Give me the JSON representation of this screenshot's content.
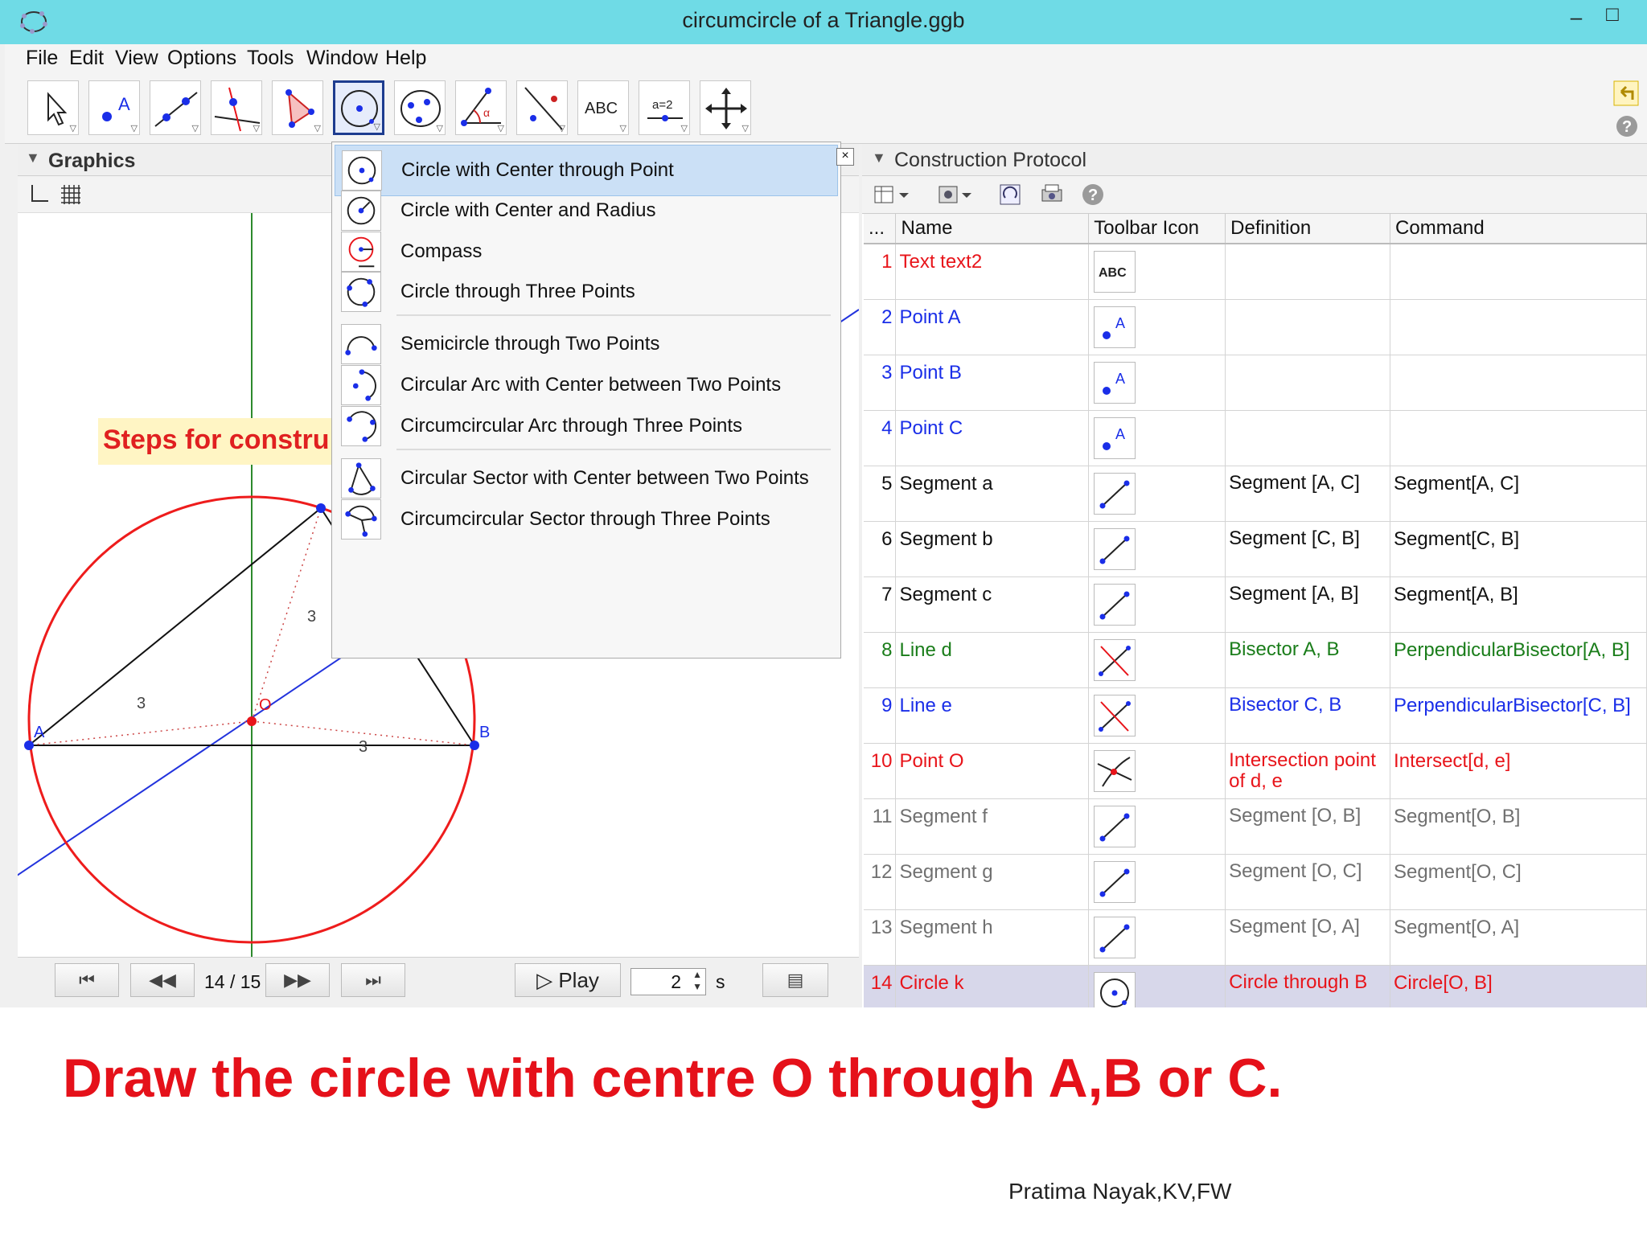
{
  "window": {
    "title": "circumcircle of a Triangle.ggb",
    "controls": [
      "minimize-icon",
      "maximize-icon"
    ]
  },
  "menubar": [
    "File",
    "Edit",
    "View",
    "Options",
    "Tools",
    "Window",
    "Help"
  ],
  "toolbar": {
    "tools": [
      "move-icon",
      "point-icon",
      "line-icon",
      "perpendicular-line-icon",
      "polygon-icon",
      "circle-center-point-icon",
      "conic-icon",
      "angle-icon",
      "reflect-icon",
      "text-tool-icon",
      "slider-icon",
      "move-graphics-view-icon"
    ],
    "text_tool_label": "ABC",
    "slider_label": "a=2",
    "right_icons": [
      "undo-icon",
      "help-icon"
    ]
  },
  "graphics": {
    "title": "Graphics",
    "banner": "Steps for constru",
    "point_labels": {
      "A": "A",
      "B": "B",
      "O": "O"
    },
    "segment_labels": [
      "3",
      "3",
      "3"
    ]
  },
  "navigation": {
    "step": "14 / 15",
    "play_label": "Play",
    "speed_value": "2",
    "speed_unit": "s"
  },
  "dropdown": {
    "items": [
      {
        "label": "Circle with Center through Point",
        "icon": "circle-center-point-icon",
        "selected": true
      },
      {
        "label": "Circle with Center and Radius",
        "icon": "circle-center-radius-icon"
      },
      {
        "label": "Compass",
        "icon": "compass-icon"
      },
      {
        "label": "Circle through Three Points",
        "icon": "circle-three-points-icon"
      },
      {
        "label": "Semicircle through Two Points",
        "icon": "semicircle-icon"
      },
      {
        "label": "Circular Arc with Center between Two Points",
        "icon": "circular-arc-icon"
      },
      {
        "label": "Circumcircular Arc through Three Points",
        "icon": "circumcircular-arc-icon"
      },
      {
        "label": "Circular Sector with Center between Two Points",
        "icon": "circular-sector-icon"
      },
      {
        "label": "Circumcircular Sector through Three Points",
        "icon": "circumcircular-sector-icon"
      }
    ],
    "close": "×"
  },
  "protocol": {
    "title": "Construction Protocol",
    "columns": [
      "...",
      "Name",
      "Toolbar Icon",
      "Definition",
      "Command"
    ],
    "rows": [
      {
        "num": "1",
        "name": "Text text2",
        "icon": "text-tool-icon",
        "definition": "",
        "command": "",
        "color": "#e8141a"
      },
      {
        "num": "2",
        "name": "Point A",
        "icon": "point-icon",
        "definition": "",
        "command": "",
        "color": "#1a2ee8"
      },
      {
        "num": "3",
        "name": "Point B",
        "icon": "point-icon",
        "definition": "",
        "command": "",
        "color": "#1a2ee8"
      },
      {
        "num": "4",
        "name": "Point C",
        "icon": "point-icon",
        "definition": "",
        "command": "",
        "color": "#1a2ee8"
      },
      {
        "num": "5",
        "name": "Segment a",
        "icon": "segment-icon",
        "definition": "Segment [A, C]",
        "command": "Segment[A, C]",
        "color": "#111111"
      },
      {
        "num": "6",
        "name": "Segment b",
        "icon": "segment-icon",
        "definition": "Segment [C, B]",
        "command": "Segment[C, B]",
        "color": "#111111"
      },
      {
        "num": "7",
        "name": "Segment c",
        "icon": "segment-icon",
        "definition": "Segment [A, B]",
        "command": "Segment[A, B]",
        "color": "#111111"
      },
      {
        "num": "8",
        "name": "Line d",
        "icon": "perpendicular-bisector-icon",
        "definition": "Bisector A, B",
        "command": "PerpendicularBisector[A, B]",
        "color": "#1a7d1a"
      },
      {
        "num": "9",
        "name": "Line e",
        "icon": "perpendicular-bisector-icon",
        "definition": "Bisector C, B",
        "command": "PerpendicularBisector[C, B]",
        "color": "#1a2ee8"
      },
      {
        "num": "10",
        "name": "Point O",
        "icon": "intersect-icon",
        "definition": "Intersection point of d, e",
        "command": "Intersect[d, e]",
        "color": "#e8141a"
      },
      {
        "num": "11",
        "name": "Segment f",
        "icon": "segment-icon",
        "definition": "Segment [O, B]",
        "command": "Segment[O, B]",
        "color": "#707070"
      },
      {
        "num": "12",
        "name": "Segment g",
        "icon": "segment-icon",
        "definition": "Segment [O, C]",
        "command": "Segment[O, C]",
        "color": "#707070"
      },
      {
        "num": "13",
        "name": "Segment h",
        "icon": "segment-icon",
        "definition": "Segment [O, A]",
        "command": "Segment[O, A]",
        "color": "#707070"
      },
      {
        "num": "14",
        "name": "Circle k",
        "icon": "circle-center-point-icon",
        "definition": "Circle through B",
        "command": "Circle[O, B]",
        "color": "#e8141a",
        "highlight": true
      }
    ]
  },
  "caption": "Draw the circle with centre O through A,B or C.",
  "credit": "Pratima Nayak,KV,FW"
}
